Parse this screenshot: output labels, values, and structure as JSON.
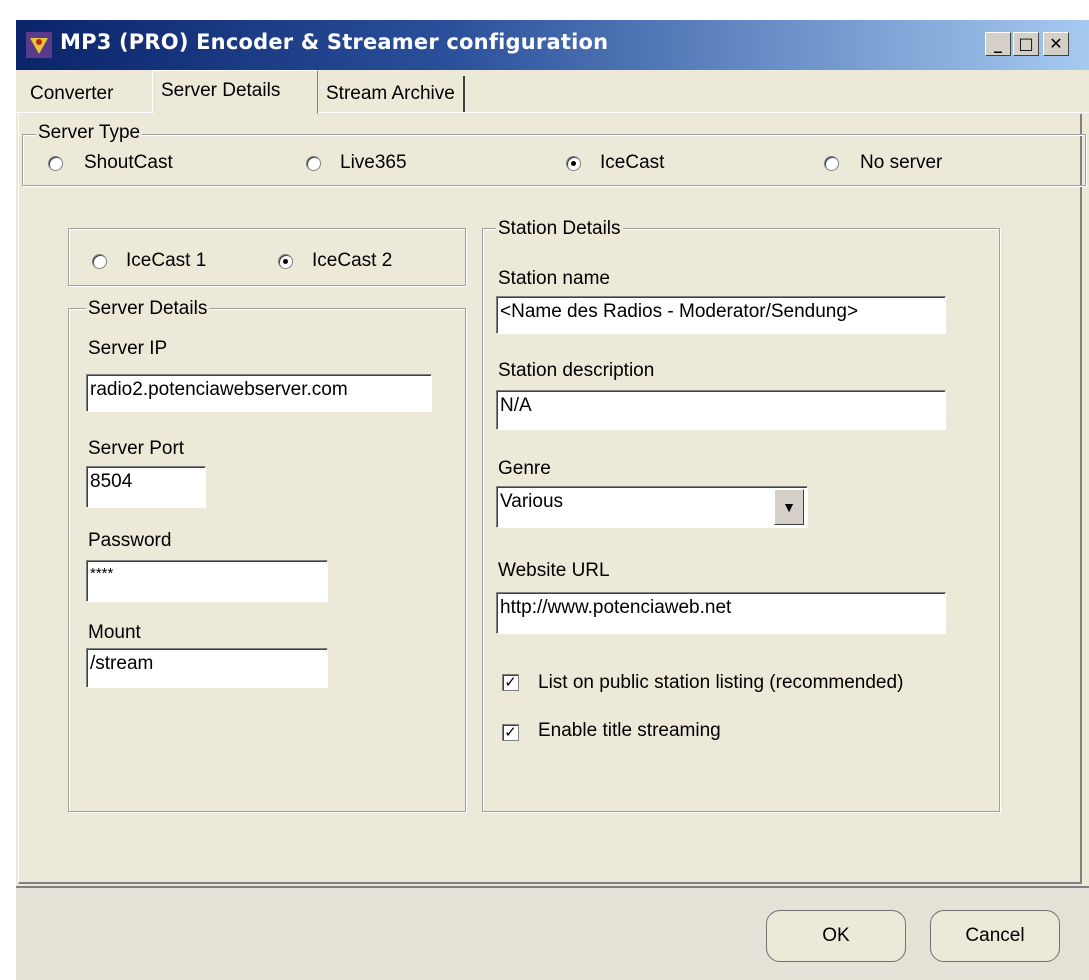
{
  "window": {
    "title": "MP3 (PRO) Encoder & Streamer configuration",
    "controls": {
      "minimize": "_",
      "maximize": "□",
      "close": "✕"
    },
    "title_gradient": [
      "#0a246a",
      "#a6caf0"
    ]
  },
  "tabs": [
    {
      "label": "Converter",
      "selected": false
    },
    {
      "label": "Server Details",
      "selected": true
    },
    {
      "label": "Stream Archive",
      "selected": false
    }
  ],
  "server_type": {
    "legend": "Server Type",
    "options": [
      "ShoutCast",
      "Live365",
      "IceCast",
      "No server"
    ],
    "selected": "IceCast"
  },
  "icecast_version": {
    "options": [
      "IceCast 1",
      "IceCast 2"
    ],
    "selected": "IceCast 2"
  },
  "server_details": {
    "legend": "Server Details",
    "server_ip_label": "Server IP",
    "server_ip_value": "radio2.potenciawebserver.com",
    "server_port_label": "Server Port",
    "server_port_value": "8504",
    "password_label": "Password",
    "password_value": "****",
    "mount_label": "Mount",
    "mount_value": "/stream"
  },
  "station_details": {
    "legend": "Station Details",
    "station_name_label": "Station name",
    "station_name_value": "<Name des Radios - Moderator/Sendung>",
    "station_description_label": "Station description",
    "station_description_value": "N/A",
    "genre_label": "Genre",
    "genre_value": "Various",
    "website_url_label": "Website URL",
    "website_url_value": "http://www.potenciaweb.net",
    "list_public_label": "List on public station listing (recommended)",
    "list_public_checked": true,
    "title_streaming_label": "Enable title streaming",
    "title_streaming_checked": true
  },
  "footer": {
    "ok_label": "OK",
    "cancel_label": "Cancel"
  }
}
